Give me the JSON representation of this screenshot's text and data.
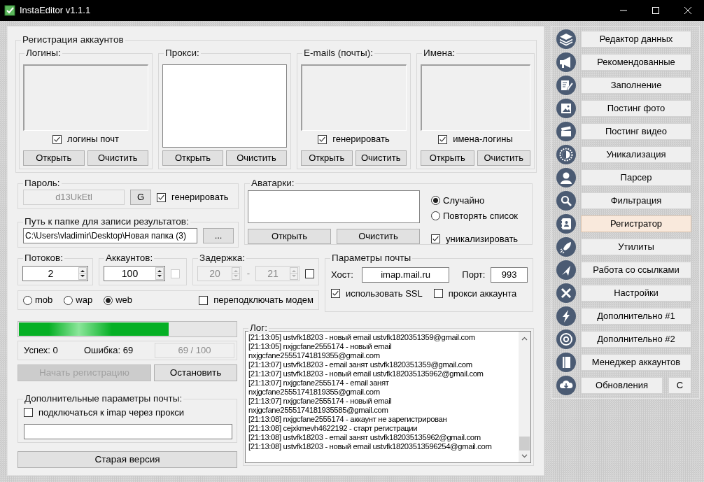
{
  "window": {
    "title": "InstaEditor v1.1.1"
  },
  "registration": {
    "title": "Регистрация аккаунтов",
    "lists": [
      {
        "label": "Логины:",
        "enabled": false,
        "checkbox": {
          "label": "логины почт",
          "checked": true
        },
        "buttons": [
          "Открыть",
          "Очистить"
        ]
      },
      {
        "label": "Прокси:",
        "enabled": true,
        "buttons": [
          "Открыть",
          "Очистить"
        ]
      },
      {
        "label": "E-mails (почты):",
        "enabled": false,
        "checkbox": {
          "label": "генерировать",
          "checked": true
        },
        "buttons": [
          "Открыть",
          "Очистить"
        ]
      },
      {
        "label": "Имена:",
        "enabled": false,
        "checkbox": {
          "label": "имена-логины",
          "checked": true
        },
        "buttons": [
          "Открыть",
          "Очистить"
        ]
      }
    ]
  },
  "password": {
    "label": "Пароль:",
    "value": "d13UkEtl",
    "disabled": true,
    "button": "G",
    "checkbox": {
      "label": "генерировать",
      "checked": true
    }
  },
  "output_path": {
    "label": "Путь к папке для записи результатов:",
    "value": "C:\\Users\\vladimir\\Desktop\\Новая папка (3)",
    "button": "..."
  },
  "avatars": {
    "label": "Аватарки:",
    "buttons": [
      "Открыть",
      "Очистить"
    ],
    "options": [
      {
        "label": "Случайно",
        "selected": true
      },
      {
        "label": "Повторять список",
        "selected": false
      }
    ],
    "checkbox": {
      "label": "уникализировать",
      "checked": true
    }
  },
  "threads": {
    "label": "Потоков:",
    "value": "2"
  },
  "accounts": {
    "label": "Аккаунтов:",
    "value": "100",
    "checkbox": {
      "checked": false,
      "disabled": true
    }
  },
  "delay": {
    "label": "Задержка:",
    "from": "20",
    "separator": "-",
    "to": "21",
    "disabled": true,
    "checkbox": {
      "checked": false
    }
  },
  "mail_params": {
    "label": "Параметры почты",
    "host_label": "Хост:",
    "host": "imap.mail.ru",
    "port_label": "Порт:",
    "port": "993",
    "checkboxes": [
      {
        "label": "использовать SSL",
        "checked": true
      },
      {
        "label": "прокси аккаунта",
        "checked": false
      }
    ]
  },
  "modes": [
    {
      "label": "mob",
      "selected": false
    },
    {
      "label": "wap",
      "selected": false
    },
    {
      "label": "web",
      "selected": true
    }
  ],
  "reconnect": {
    "label": "переподключать модем",
    "checked": false
  },
  "progress": {
    "level": 0.69
  },
  "stats": {
    "success": "Успех: 0",
    "errors": "Ошибка: 69",
    "counter": "69 / 100"
  },
  "actions": [
    {
      "label": "Начать регистрацию",
      "disabled": true
    },
    {
      "label": "Остановить",
      "disabled": false
    }
  ],
  "extra_mail": {
    "label": "Дополнительные параметры почты:",
    "checkbox": {
      "label": "подключаться к imap через прокси",
      "checked": false
    }
  },
  "old_version_button": "Старая версия",
  "log": {
    "label": "Лог:",
    "lines": [
      "[21:13:05] ustvfk18203 - новый email ustvfk1820351359@gmail.com",
      "[21:13:05] nxjgcfane2555174 - новый email nxjgcfane25551741819355@gmail.com",
      "[21:13:07] ustvfk18203 - email занят ustvfk1820351359@gmail.com",
      "[21:13:07] ustvfk18203 - новый email ustvfk182035135962@gmail.com",
      "[21:13:07] nxjgcfane2555174 - email занят nxjgcfane25551741819355@gmail.com",
      "[21:13:07] nxjgcfane2555174 - новый email nxjgcfane2555174181935585@gmail.com",
      "[21:13:08] nxjgcfane2555174 - аккаунт не зарегистрирован",
      "[21:13:08] cejxkmevh4622192 - старт регистрации",
      "[21:13:08] ustvfk18203 - email занят ustvfk182035135962@gmail.com",
      "[21:13:08] ustvfk18203 - новый email ustvfk18203513596254@gmail.com"
    ]
  },
  "sidebar": {
    "items": [
      {
        "label": "Редактор данных",
        "selected": false
      },
      {
        "label": "Рекомендованные",
        "selected": false
      },
      {
        "label": "Заполнение",
        "selected": false
      },
      {
        "label": "Постинг фото",
        "selected": false
      },
      {
        "label": "Постинг видео",
        "selected": false
      },
      {
        "label": "Уникализация",
        "selected": false
      },
      {
        "label": "Парсер",
        "selected": false
      },
      {
        "label": "Фильтрация",
        "selected": false
      },
      {
        "label": "Регистратор",
        "selected": true
      },
      {
        "label": "Утилиты",
        "selected": false
      },
      {
        "label": "Работа со ссылками",
        "selected": false
      },
      {
        "label": "Настройки",
        "selected": false
      },
      {
        "label": "Дополнительно #1",
        "selected": false
      },
      {
        "label": "Дополнительно #2",
        "selected": false
      },
      {
        "label": "Менеджер аккаунтов",
        "selected": false
      },
      {
        "label": "Обновления",
        "selected": false,
        "extra_button": "C"
      }
    ]
  }
}
